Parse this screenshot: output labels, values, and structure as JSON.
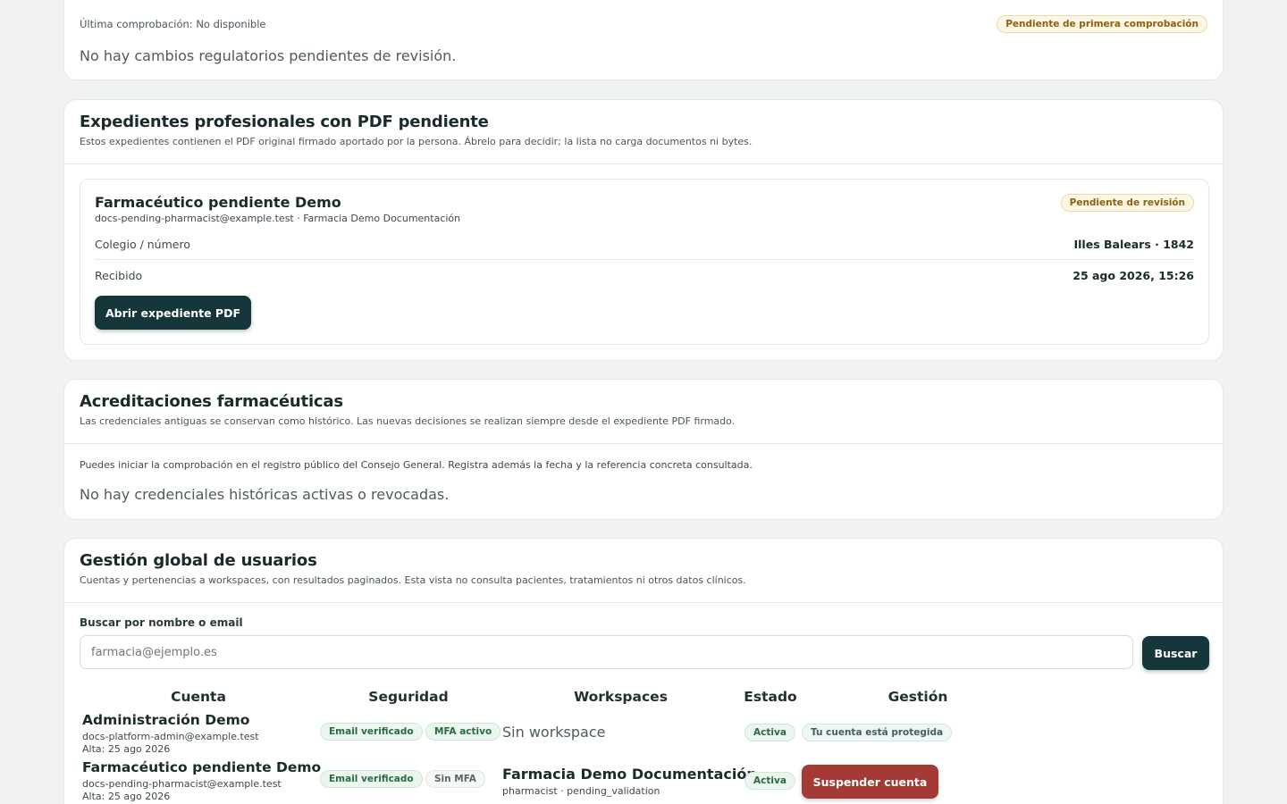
{
  "regulatory": {
    "last_check": "Última comprobación: No disponible",
    "status_badge": "Pendiente de primera comprobación",
    "empty_text": "No hay cambios regulatorios pendientes de revisión."
  },
  "pending_pdf": {
    "title": "Expedientes profesionales con PDF pendiente",
    "subtitle": "Estos expedientes contienen el PDF original firmado aportado por la persona. Ábrelo para decidir; la lista no carga documentos ni bytes.",
    "item": {
      "name": "Farmacéutico pendiente Demo",
      "meta": "docs-pending-pharmacist@example.test · Farmacia Demo Documentación",
      "badge": "Pendiente de revisión",
      "college_label": "Colegio / número",
      "college_value": "Illes Balears · 1842",
      "received_label": "Recibido",
      "received_value": "25 ago 2026, 15:26",
      "open_button": "Abrir expediente PDF"
    }
  },
  "accreditations": {
    "title": "Acreditaciones farmacéuticas",
    "subtitle": "Las credenciales antiguas se conservan como histórico. Las nuevas decisiones se realizan siempre desde el expediente PDF firmado.",
    "info": "Puedes iniciar la comprobación en el registro público del Consejo General. Registra además la fecha y la referencia concreta consultada.",
    "empty_text": "No hay credenciales históricas activas o revocadas."
  },
  "users": {
    "title": "Gestión global de usuarios",
    "subtitle": "Cuentas y pertenencias a workspaces, con resultados paginados. Esta vista no consulta pacientes, tratamientos ni otros datos clínicos.",
    "search_label": "Buscar por nombre o email",
    "search_placeholder": "farmacia@ejemplo.es",
    "search_button": "Buscar",
    "columns": [
      "Cuenta",
      "Seguridad",
      "Workspaces",
      "Estado",
      "Gestión"
    ],
    "rows": [
      {
        "name": "Administración Demo",
        "email": "docs-platform-admin@example.test",
        "created": "Alta: 25 ago 2026",
        "security": [
          "Email verificado",
          "MFA activo"
        ],
        "workspace": "Sin workspace",
        "workspace_detail": "",
        "status": "Activa",
        "management": "Tu cuenta está protegida"
      },
      {
        "name": "Farmacéutico pendiente Demo",
        "email": "docs-pending-pharmacist@example.test",
        "created": "Alta: 25 ago 2026",
        "security": [
          "Email verificado",
          "Sin MFA"
        ],
        "workspace": "Farmacia Demo Documentación",
        "workspace_detail": "pharmacist · pending_validation",
        "status": "Activa",
        "management": "Suspender cuenta"
      }
    ]
  }
}
